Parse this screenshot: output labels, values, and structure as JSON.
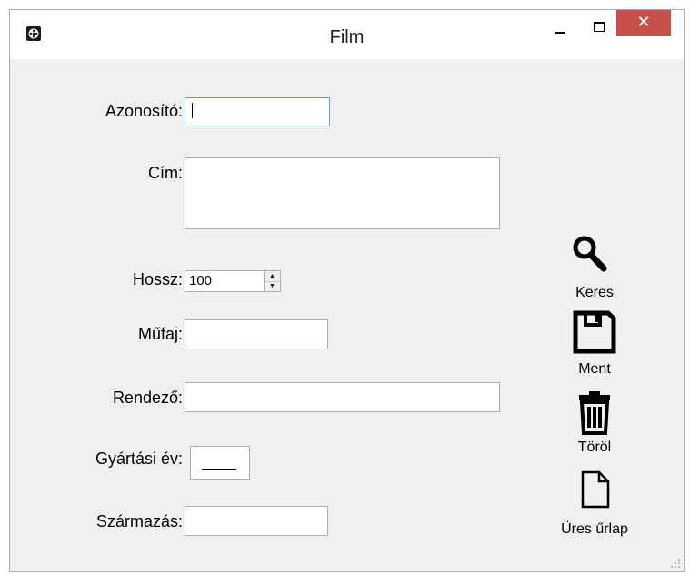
{
  "window": {
    "title": "Film"
  },
  "titlebar": {
    "close_symbol": "✕"
  },
  "form": {
    "azonosito_label": "Azonosító:",
    "azonosito_value": "",
    "cim_label": "Cím:",
    "cim_value": "",
    "hossz_label": "Hossz:",
    "hossz_value": "100",
    "mufaj_label": "Műfaj:",
    "mufaj_value": "",
    "rendezo_label": "Rendező:",
    "rendezo_value": "",
    "gyartasi_ev_label": "Gyártási év:",
    "szarmazas_label": "Származás:",
    "szarmazas_value": ""
  },
  "actions": {
    "keres": "Keres",
    "ment": "Ment",
    "torol": "Töröl",
    "ures_urlap": "Üres űrlap"
  },
  "icons": {
    "app": "film-reel-icon",
    "search": "magnifier-icon",
    "save": "floppy-disk-icon",
    "delete": "trash-can-icon",
    "new": "blank-document-icon"
  }
}
